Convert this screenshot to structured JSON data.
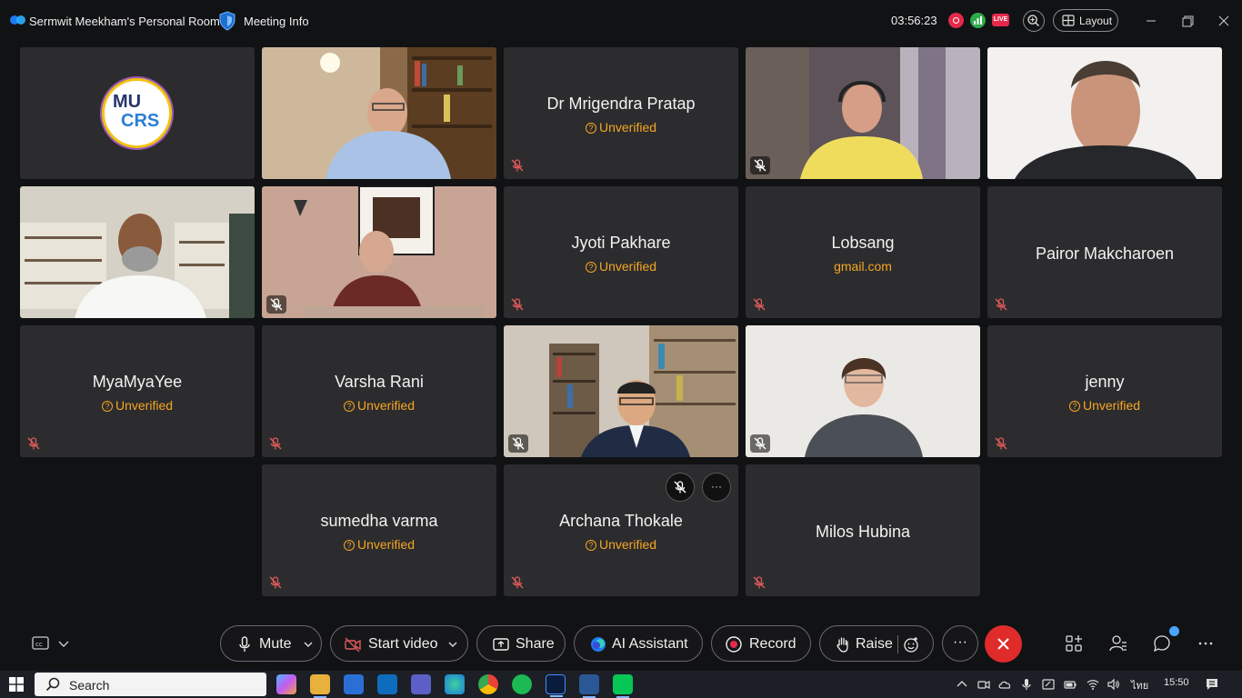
{
  "titlebar": {
    "room_title": "Sermwit Meekham's Personal Room",
    "meeting_info": "Meeting Info",
    "timer": "03:56:23",
    "live": "LIVE",
    "layout": "Layout"
  },
  "participants": [
    {
      "name": "MU CRS",
      "logo_top": "MU",
      "logo_bottom": "CRS"
    },
    {
      "name": "Dr Mrigendra Pratap",
      "status": "Unverified"
    },
    {
      "name": "Jyoti Pakhare",
      "status": "Unverified"
    },
    {
      "name": "Lobsang",
      "status": "gmail.com"
    },
    {
      "name": "Pairor Makcharoen"
    },
    {
      "name": "MyaMyaYee",
      "status": "Unverified"
    },
    {
      "name": "Varsha Rani",
      "status": "Unverified"
    },
    {
      "name": "jenny",
      "status": "Unverified"
    },
    {
      "name": "sumedha varma",
      "status": "Unverified"
    },
    {
      "name": "Archana Thokale",
      "status": "Unverified"
    },
    {
      "name": "Milos Hubina"
    }
  ],
  "tile_more": "···",
  "toolbar": {
    "mute": "Mute",
    "start_video": "Start video",
    "share": "Share",
    "ai_assistant": "AI Assistant",
    "record": "Record",
    "raise": "Raise",
    "more": "···"
  },
  "taskbar": {
    "search": "Search",
    "lang": "ไทย",
    "time": "15:50"
  },
  "colors": {
    "unverified": "#f5a623",
    "end_call": "#e02b2b",
    "tile_bg": "#2c2c2e"
  }
}
